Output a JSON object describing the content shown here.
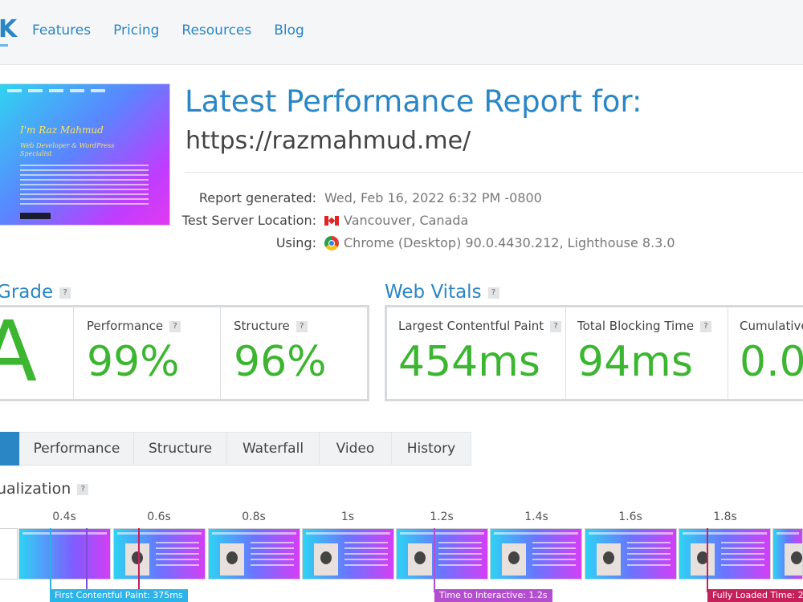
{
  "nav": {
    "items": [
      "Features",
      "Pricing",
      "Resources",
      "Blog"
    ]
  },
  "report": {
    "title": "Latest Performance Report for:",
    "url": "https://razmahmud.me/",
    "generated_label": "Report generated:",
    "generated_value": "Wed, Feb 16, 2022 6:32 PM -0800",
    "location_label": "Test Server Location:",
    "location_value": "Vancouver, Canada",
    "using_label": "Using:",
    "using_value": "Chrome (Desktop) 90.0.4430.212, Lighthouse 8.3.0"
  },
  "thumbnail": {
    "heading": "I'm Raz Mahmud",
    "subheading": "Web Developer & WordPress Specialist"
  },
  "grade": {
    "heading_fragment": "Grade",
    "letter": "A",
    "performance_label": "Performance",
    "performance_value": "99%",
    "structure_label": "Structure",
    "structure_value": "96%"
  },
  "vitals": {
    "heading": "Web Vitals",
    "lcp_label": "Largest Contentful Paint",
    "lcp_value": "454ms",
    "tbt_label": "Total Blocking Time",
    "tbt_value": "94ms",
    "cls_label": "Cumulative",
    "cls_value": "0.0"
  },
  "tabs": [
    "Performance",
    "Structure",
    "Waterfall",
    "Video",
    "History"
  ],
  "visualization": {
    "heading_fragment": "ualization",
    "ticks": [
      "0.4s",
      "0.6s",
      "0.8s",
      "1s",
      "1.2s",
      "1.4s",
      "1.6s",
      "1.8s"
    ],
    "markers": {
      "fcp": "First Contentful Paint: 375ms",
      "tti": "Time to Interactive: 1.2s",
      "fully_loaded": "Fully Loaded Time: 2"
    }
  },
  "colors": {
    "accent": "#2a86c5",
    "good": "#3cb531",
    "fcp": "#2eb3e8",
    "tti": "#b34fcf",
    "fully_loaded": "#c4215a"
  }
}
